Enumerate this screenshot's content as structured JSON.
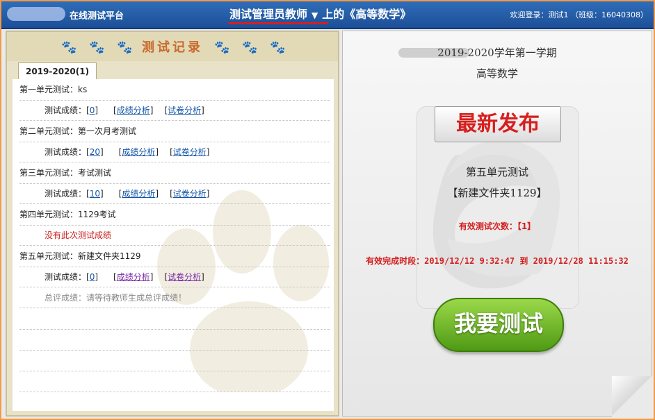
{
  "header": {
    "platform": "在线测试平台",
    "role": "测试管理员教师",
    "course_title": "上的《高等数学》",
    "welcome": "欢迎登录：测试1 （班级：16040308）"
  },
  "left": {
    "title": "测试记录",
    "tab": "2019-2020(1)",
    "units": [
      {
        "title": "第一单元测试：ks",
        "score_label": "测试成绩：",
        "score": "0",
        "analysis": "成绩分析",
        "paper": "试卷分析"
      },
      {
        "title": "第二单元测试：第一次月考测试",
        "score_label": "测试成绩：",
        "score": "20",
        "analysis": "成绩分析",
        "paper": "试卷分析"
      },
      {
        "title": "第三单元测试：考试测试",
        "score_label": "测试成绩：",
        "score": "10",
        "analysis": "成绩分析",
        "paper": "试卷分析"
      },
      {
        "title": "第四单元测试：1129考试",
        "no_score": "没有此次测试成绩"
      },
      {
        "title": "第五单元测试：新建文件夹1129",
        "score_label": "测试成绩：",
        "score": "0",
        "analysis": "成绩分析",
        "paper": "试卷分析"
      }
    ],
    "overall": "总评成绩：请等待教师生成总评成绩！"
  },
  "right": {
    "term": "2019-2020学年第一学期",
    "course": "高等数学",
    "newest_badge": "最新发布",
    "unit_name": "第五单元测试",
    "folder": "【新建文件夹1129】",
    "valid_count": "有效测试次数：【1】",
    "valid_period": "有效完成时段：2019/12/12 9:32:47 到 2019/12/28 11:15:32",
    "start_button": "我要测试"
  }
}
